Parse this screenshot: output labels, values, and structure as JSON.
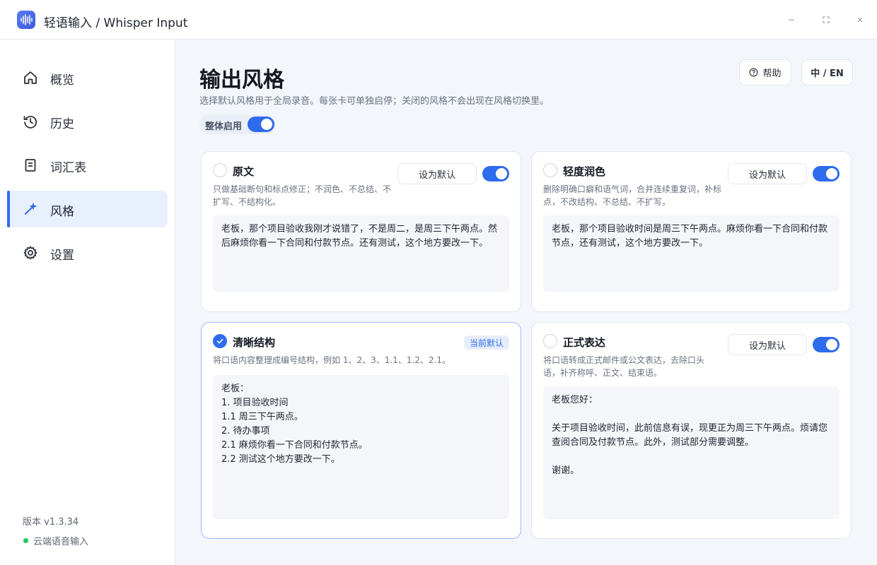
{
  "app": {
    "title": "轻语输入 / Whisper Input",
    "logo_icon": "waveform-icon",
    "accent": "#2f6bed"
  },
  "sidebar": {
    "items": [
      {
        "label": "概览",
        "icon": "home-icon",
        "active": false
      },
      {
        "label": "历史",
        "icon": "history-icon",
        "active": false
      },
      {
        "label": "词汇表",
        "icon": "document-icon",
        "active": false
      },
      {
        "label": "风格",
        "icon": "magic-wand-icon",
        "active": true
      },
      {
        "label": "设置",
        "icon": "gear-icon",
        "active": false
      }
    ],
    "version": "版本 v1.3.34",
    "status": "云端语音输入",
    "status_color": "#22c55e"
  },
  "header": {
    "title": "输出风格",
    "description": "选择默认风格用于全局录音。每张卡可单独启停；关闭的风格不会出现在风格切换里。",
    "master_label": "整体启用",
    "master_enabled": true,
    "help_label": "帮助",
    "lang_label": "中 / EN"
  },
  "cards": [
    {
      "title": "原文",
      "description": "只做基础断句和标点修正；不润色、不总结、不扩写、不结构化。",
      "set_default_label": "设为默认",
      "enabled": true,
      "selected": false,
      "preview": "老板，那个项目验收我刚才说错了，不是周二，是周三下午两点。然后麻烦你看一下合同和付款节点。还有测试，这个地方要改一下。"
    },
    {
      "title": "轻度润色",
      "description": "删除明确口癖和语气词，合并连续重复词，补标点，不改结构、不总结、不扩写。",
      "set_default_label": "设为默认",
      "enabled": true,
      "selected": false,
      "preview": "老板，那个项目验收时间是周三下午两点。麻烦你看一下合同和付款节点，还有测试，这个地方要改一下。"
    },
    {
      "title": "清晰结构",
      "description": "将口语内容整理成编号结构，例如 1、2、3、1.1、1.2、2.1。",
      "badge": "当前默认",
      "selected": true,
      "preview": "老板：\n1. 项目验收时间\n1.1 周三下午两点。\n2. 待办事项\n2.1 麻烦你看一下合同和付款节点。\n2.2 测试这个地方要改一下。"
    },
    {
      "title": "正式表达",
      "description": "将口语转成正式邮件或公文表达，去除口头语，补齐称呼、正文、结束语。",
      "set_default_label": "设为默认",
      "enabled": true,
      "selected": false,
      "preview": "老板您好：\n\n关于项目验收时间，此前信息有误，现更正为周三下午两点。烦请您查阅合同及付款节点。此外，测试部分需要调整。\n\n谢谢。"
    }
  ]
}
